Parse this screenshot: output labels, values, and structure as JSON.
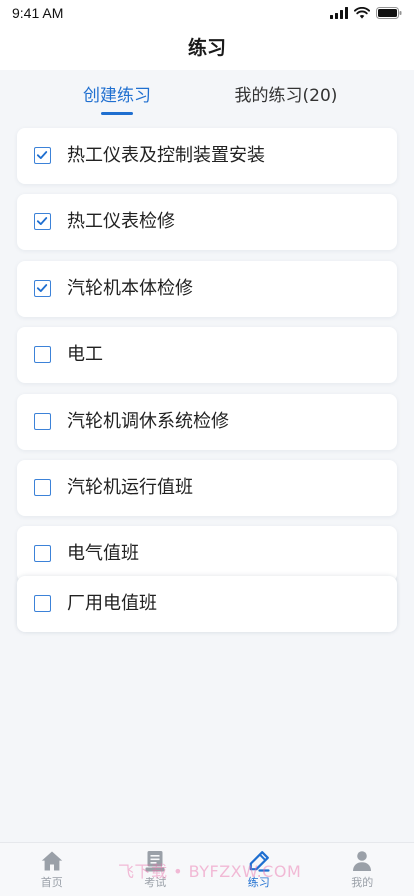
{
  "status_bar": {
    "time": "9:41 AM",
    "icons": [
      "signal-icon",
      "wifi-icon",
      "battery-icon"
    ]
  },
  "header": {
    "title": "练习"
  },
  "tabs": [
    {
      "label": "创建练习",
      "active": true
    },
    {
      "label": "我的练习(20)",
      "active": false
    }
  ],
  "practice_list": [
    {
      "label": "热工仪表及控制装置安装",
      "checked": true
    },
    {
      "label": "热工仪表检修",
      "checked": true
    },
    {
      "label": "汽轮机本体检修",
      "checked": true
    },
    {
      "label": "电工",
      "checked": false
    },
    {
      "label": "汽轮机调休系统检修",
      "checked": false
    },
    {
      "label": "汽轮机运行值班",
      "checked": false
    },
    {
      "label": "电气值班",
      "checked": false
    },
    {
      "label": "厂用电值班",
      "checked": false
    }
  ],
  "tab_bar": [
    {
      "label": "首页",
      "icon": "home-icon",
      "active": false
    },
    {
      "label": "考试",
      "icon": "exam-icon",
      "active": false
    },
    {
      "label": "练习",
      "icon": "pencil-icon",
      "active": true
    },
    {
      "label": "我的",
      "icon": "user-icon",
      "active": false
    }
  ],
  "watermark": {
    "text": "飞下载 • BYFZXW.COM"
  },
  "colors": {
    "accent": "#1f6fd0",
    "background": "#f4f6f9",
    "card": "#ffffff",
    "text": "#222222",
    "inactive": "#9aa0a8",
    "watermark": "#eb6eaa"
  }
}
